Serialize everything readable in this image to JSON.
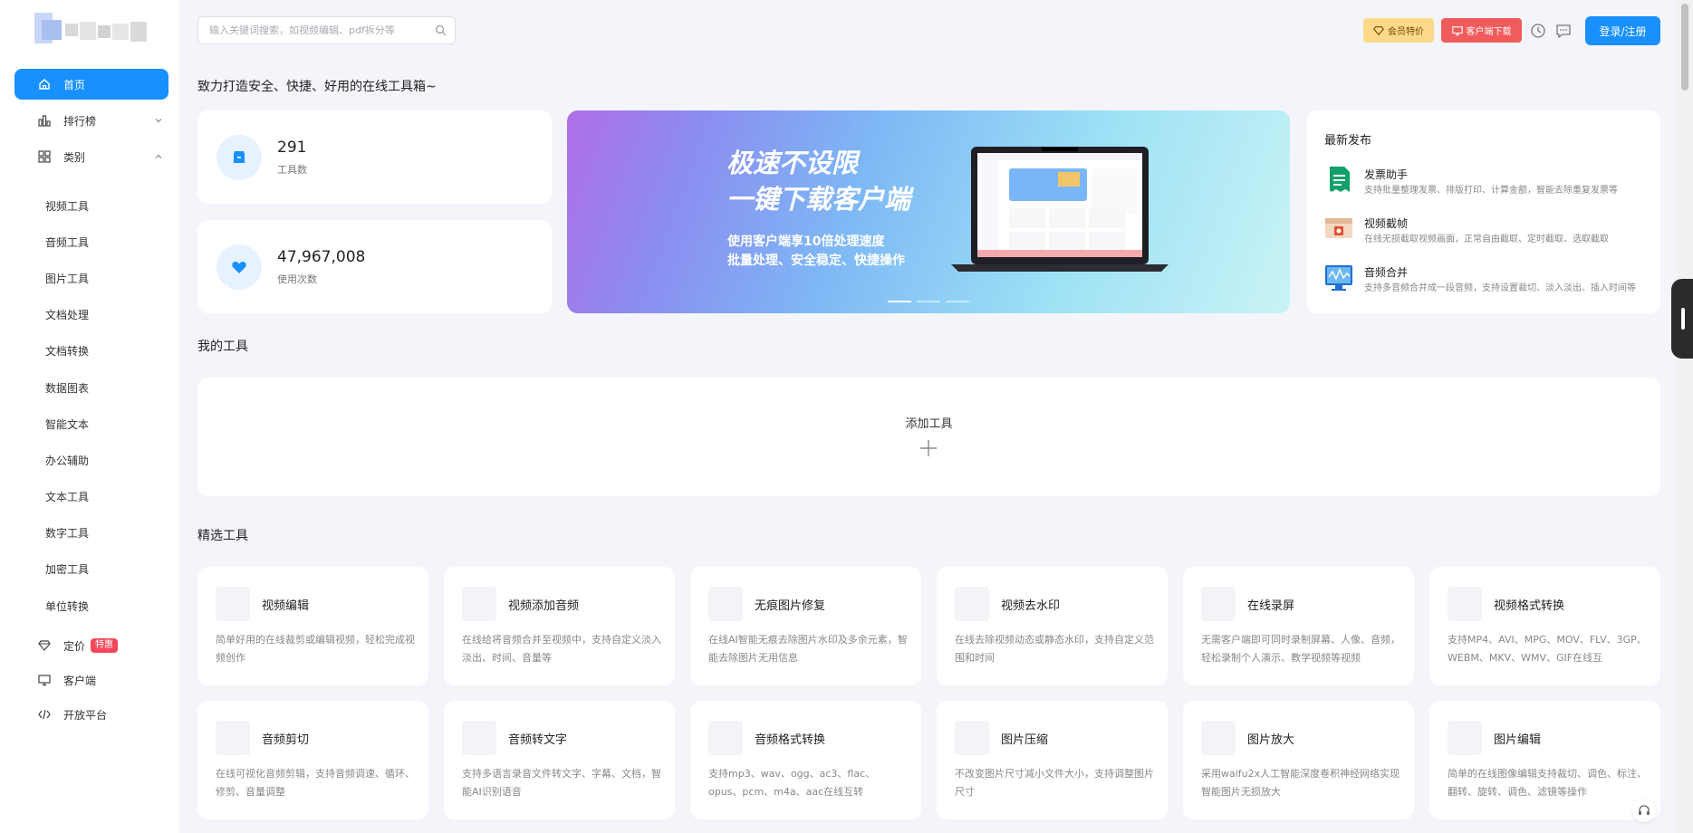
{
  "search": {
    "placeholder": "输入关键词搜索，如视频编辑、pdf拆分等"
  },
  "header": {
    "vip_label": "会员特价",
    "download_label": "客户端下载",
    "login_label": "登录/注册"
  },
  "sidebar": {
    "main": [
      {
        "label": "首页",
        "icon": "home-icon",
        "active": true
      },
      {
        "label": "排行榜",
        "icon": "bar-chart-icon",
        "expand": "chevron-down-icon"
      },
      {
        "label": "类别",
        "icon": "grid-icon",
        "expand": "chevron-up-icon"
      }
    ],
    "categories": [
      "视频工具",
      "音频工具",
      "图片工具",
      "文档处理",
      "文档转换",
      "数据图表",
      "智能文本",
      "办公辅助",
      "文本工具",
      "数字工具",
      "加密工具",
      "单位转换"
    ],
    "bottom": [
      {
        "label": "定价",
        "icon": "diamond-icon",
        "badge": "特惠"
      },
      {
        "label": "客户端",
        "icon": "monitor-icon"
      },
      {
        "label": "开放平台",
        "icon": "code-icon"
      }
    ]
  },
  "slogan": "致力打造安全、快捷、好用的在线工具箱~",
  "stats": [
    {
      "value": "291",
      "label": "工具数",
      "icon": "box-icon"
    },
    {
      "value": "47,967,008",
      "label": "使用次数",
      "icon": "heart-icon"
    }
  ],
  "banner": {
    "title_line1": "极速不设限",
    "title_line2": "一键下载客户端",
    "sub_line1": "使用客户端享10倍处理速度",
    "sub_line2": "批量处理、安全稳定、快捷操作"
  },
  "news": {
    "title": "最新发布",
    "items": [
      {
        "name": "发票助手",
        "desc": "支持批量整理发票、排版打印、计算金额，智能去除重复发票等",
        "icon": "invoice-icon"
      },
      {
        "name": "视频截帧",
        "desc": "在线无损截取视频画面，正常自由截取、定时截取、选取截取",
        "icon": "video-frame-icon"
      },
      {
        "name": "音频合并",
        "desc": "支持多音频合并成一段音频，支持设置裁切、淡入淡出、插入时间等",
        "icon": "audio-merge-icon"
      }
    ]
  },
  "my_tools": {
    "title": "我的工具",
    "add_label": "添加工具"
  },
  "featured": {
    "title": "精选工具",
    "items": [
      {
        "name": "视频编辑",
        "desc": "简单好用的在线裁剪或编辑视频，轻松完成视频创作"
      },
      {
        "name": "视频添加音频",
        "desc": "在线给将音频合并至视频中，支持自定义淡入淡出、时间、音量等"
      },
      {
        "name": "无痕图片修复",
        "desc": "在线AI智能无痕去除图片水印及多余元素，智能去除图片无用信息"
      },
      {
        "name": "视频去水印",
        "desc": "在线去除视频动态或静态水印，支持自定义范围和时间"
      },
      {
        "name": "在线录屏",
        "desc": "无需客户端即可同时录制屏幕、人像、音频，轻松录制个人演示、教学视频等视频"
      },
      {
        "name": "视频格式转换",
        "desc": "支持MP4、AVI、MPG、MOV、FLV、3GP、WEBM、MKV、WMV、GIF在线互"
      },
      {
        "name": "音频剪切",
        "desc": "在线可视化音频剪辑，支持音频调速、循环、修剪、音量调整"
      },
      {
        "name": "音频转文字",
        "desc": "支持多语言录音文件转文字、字幕、文档，智能AI识别语音"
      },
      {
        "name": "音频格式转换",
        "desc": "支持mp3、wav、ogg、ac3、flac、opus、pcm、m4a、aac在线互转"
      },
      {
        "name": "图片压缩",
        "desc": "不改变图片尺寸减小文件大小，支持调整图片尺寸"
      },
      {
        "name": "图片放大",
        "desc": "采用waifu2x人工智能深度卷积神经网络实现智能图片无损放大"
      },
      {
        "name": "图片编辑",
        "desc": "简单的在线图像编辑支持裁切、调色、标注、翻转、旋转、调色、滤镜等操作"
      }
    ]
  },
  "colors": {
    "primary": "#1890ff",
    "vip": "#ffd98a",
    "download": "#f25b5b",
    "hot": "#f5475a",
    "bg": "#f4f5fa"
  }
}
